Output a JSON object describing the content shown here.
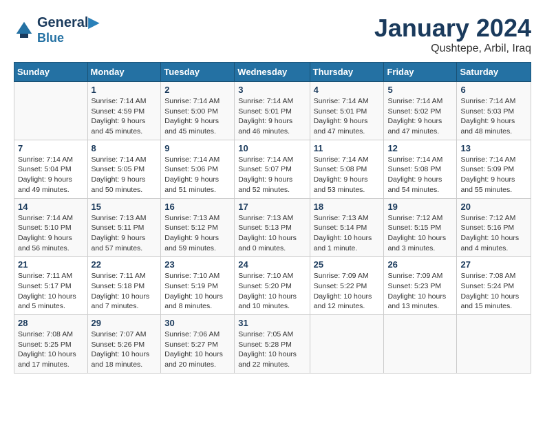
{
  "header": {
    "logo_line1": "General",
    "logo_line2": "Blue",
    "month_title": "January 2024",
    "location": "Qushtepe, Arbil, Iraq"
  },
  "weekdays": [
    "Sunday",
    "Monday",
    "Tuesday",
    "Wednesday",
    "Thursday",
    "Friday",
    "Saturday"
  ],
  "weeks": [
    [
      {
        "day": "",
        "info": ""
      },
      {
        "day": "1",
        "info": "Sunrise: 7:14 AM\nSunset: 4:59 PM\nDaylight: 9 hours\nand 45 minutes."
      },
      {
        "day": "2",
        "info": "Sunrise: 7:14 AM\nSunset: 5:00 PM\nDaylight: 9 hours\nand 45 minutes."
      },
      {
        "day": "3",
        "info": "Sunrise: 7:14 AM\nSunset: 5:01 PM\nDaylight: 9 hours\nand 46 minutes."
      },
      {
        "day": "4",
        "info": "Sunrise: 7:14 AM\nSunset: 5:01 PM\nDaylight: 9 hours\nand 47 minutes."
      },
      {
        "day": "5",
        "info": "Sunrise: 7:14 AM\nSunset: 5:02 PM\nDaylight: 9 hours\nand 47 minutes."
      },
      {
        "day": "6",
        "info": "Sunrise: 7:14 AM\nSunset: 5:03 PM\nDaylight: 9 hours\nand 48 minutes."
      }
    ],
    [
      {
        "day": "7",
        "info": "Sunrise: 7:14 AM\nSunset: 5:04 PM\nDaylight: 9 hours\nand 49 minutes."
      },
      {
        "day": "8",
        "info": "Sunrise: 7:14 AM\nSunset: 5:05 PM\nDaylight: 9 hours\nand 50 minutes."
      },
      {
        "day": "9",
        "info": "Sunrise: 7:14 AM\nSunset: 5:06 PM\nDaylight: 9 hours\nand 51 minutes."
      },
      {
        "day": "10",
        "info": "Sunrise: 7:14 AM\nSunset: 5:07 PM\nDaylight: 9 hours\nand 52 minutes."
      },
      {
        "day": "11",
        "info": "Sunrise: 7:14 AM\nSunset: 5:08 PM\nDaylight: 9 hours\nand 53 minutes."
      },
      {
        "day": "12",
        "info": "Sunrise: 7:14 AM\nSunset: 5:08 PM\nDaylight: 9 hours\nand 54 minutes."
      },
      {
        "day": "13",
        "info": "Sunrise: 7:14 AM\nSunset: 5:09 PM\nDaylight: 9 hours\nand 55 minutes."
      }
    ],
    [
      {
        "day": "14",
        "info": "Sunrise: 7:14 AM\nSunset: 5:10 PM\nDaylight: 9 hours\nand 56 minutes."
      },
      {
        "day": "15",
        "info": "Sunrise: 7:13 AM\nSunset: 5:11 PM\nDaylight: 9 hours\nand 57 minutes."
      },
      {
        "day": "16",
        "info": "Sunrise: 7:13 AM\nSunset: 5:12 PM\nDaylight: 9 hours\nand 59 minutes."
      },
      {
        "day": "17",
        "info": "Sunrise: 7:13 AM\nSunset: 5:13 PM\nDaylight: 10 hours\nand 0 minutes."
      },
      {
        "day": "18",
        "info": "Sunrise: 7:13 AM\nSunset: 5:14 PM\nDaylight: 10 hours\nand 1 minute."
      },
      {
        "day": "19",
        "info": "Sunrise: 7:12 AM\nSunset: 5:15 PM\nDaylight: 10 hours\nand 3 minutes."
      },
      {
        "day": "20",
        "info": "Sunrise: 7:12 AM\nSunset: 5:16 PM\nDaylight: 10 hours\nand 4 minutes."
      }
    ],
    [
      {
        "day": "21",
        "info": "Sunrise: 7:11 AM\nSunset: 5:17 PM\nDaylight: 10 hours\nand 5 minutes."
      },
      {
        "day": "22",
        "info": "Sunrise: 7:11 AM\nSunset: 5:18 PM\nDaylight: 10 hours\nand 7 minutes."
      },
      {
        "day": "23",
        "info": "Sunrise: 7:10 AM\nSunset: 5:19 PM\nDaylight: 10 hours\nand 8 minutes."
      },
      {
        "day": "24",
        "info": "Sunrise: 7:10 AM\nSunset: 5:20 PM\nDaylight: 10 hours\nand 10 minutes."
      },
      {
        "day": "25",
        "info": "Sunrise: 7:09 AM\nSunset: 5:22 PM\nDaylight: 10 hours\nand 12 minutes."
      },
      {
        "day": "26",
        "info": "Sunrise: 7:09 AM\nSunset: 5:23 PM\nDaylight: 10 hours\nand 13 minutes."
      },
      {
        "day": "27",
        "info": "Sunrise: 7:08 AM\nSunset: 5:24 PM\nDaylight: 10 hours\nand 15 minutes."
      }
    ],
    [
      {
        "day": "28",
        "info": "Sunrise: 7:08 AM\nSunset: 5:25 PM\nDaylight: 10 hours\nand 17 minutes."
      },
      {
        "day": "29",
        "info": "Sunrise: 7:07 AM\nSunset: 5:26 PM\nDaylight: 10 hours\nand 18 minutes."
      },
      {
        "day": "30",
        "info": "Sunrise: 7:06 AM\nSunset: 5:27 PM\nDaylight: 10 hours\nand 20 minutes."
      },
      {
        "day": "31",
        "info": "Sunrise: 7:05 AM\nSunset: 5:28 PM\nDaylight: 10 hours\nand 22 minutes."
      },
      {
        "day": "",
        "info": ""
      },
      {
        "day": "",
        "info": ""
      },
      {
        "day": "",
        "info": ""
      }
    ]
  ]
}
